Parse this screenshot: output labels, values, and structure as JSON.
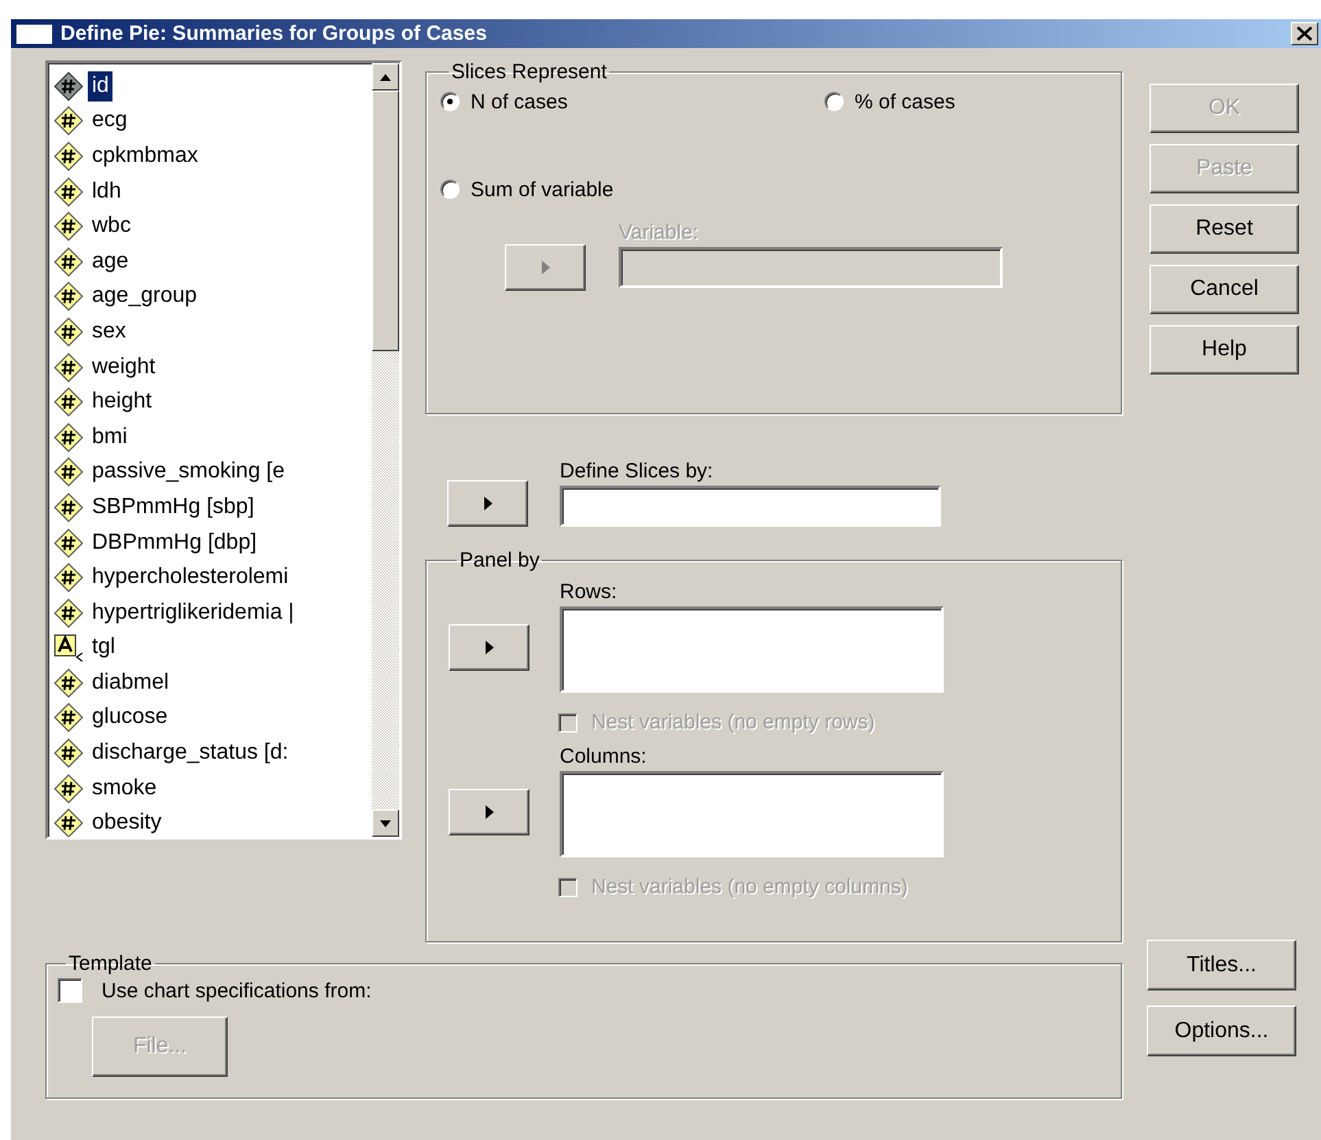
{
  "window": {
    "title": "Define Pie: Summaries for Groups of Cases"
  },
  "variables": [
    {
      "name": "id",
      "kind": "scale",
      "selected": true
    },
    {
      "name": "ecg",
      "kind": "scale",
      "selected": false
    },
    {
      "name": "cpkmbmax",
      "kind": "scale",
      "selected": false
    },
    {
      "name": "ldh",
      "kind": "scale",
      "selected": false
    },
    {
      "name": "wbc",
      "kind": "scale",
      "selected": false
    },
    {
      "name": "age",
      "kind": "scale",
      "selected": false
    },
    {
      "name": "age_group",
      "kind": "scale",
      "selected": false
    },
    {
      "name": "sex",
      "kind": "scale",
      "selected": false
    },
    {
      "name": "weight",
      "kind": "scale",
      "selected": false
    },
    {
      "name": "height",
      "kind": "scale",
      "selected": false
    },
    {
      "name": "bmi",
      "kind": "scale",
      "selected": false
    },
    {
      "name": "passive_smoking [e",
      "kind": "scale",
      "selected": false
    },
    {
      "name": "SBPmmHg [sbp]",
      "kind": "scale",
      "selected": false
    },
    {
      "name": "DBPmmHg [dbp]",
      "kind": "scale",
      "selected": false
    },
    {
      "name": "hypercholesterolemi",
      "kind": "scale",
      "selected": false
    },
    {
      "name": "hypertriglikeridemia |",
      "kind": "scale",
      "selected": false
    },
    {
      "name": "tgl",
      "kind": "string",
      "selected": false
    },
    {
      "name": "diabmel",
      "kind": "scale",
      "selected": false
    },
    {
      "name": "glucose",
      "kind": "scale",
      "selected": false
    },
    {
      "name": "discharge_status [d:",
      "kind": "scale",
      "selected": false
    },
    {
      "name": "smoke",
      "kind": "scale",
      "selected": false
    },
    {
      "name": "obesity",
      "kind": "scale",
      "selected": false
    }
  ],
  "slices_represent": {
    "label": "Slices Represent",
    "options": [
      {
        "label": "N of cases",
        "selected": true
      },
      {
        "label": "% of cases",
        "selected": false
      },
      {
        "label": "Sum of variable",
        "selected": false
      }
    ],
    "variable": {
      "label": "Variable:",
      "disabled": true
    }
  },
  "define_slices": {
    "label": "Define Slices by:"
  },
  "panel_by": {
    "label": "Panel by",
    "rows": {
      "label": "Rows:",
      "nest": {
        "label": "Nest variables (no empty rows)",
        "checked": false,
        "disabled": true
      }
    },
    "columns": {
      "label": "Columns:",
      "nest": {
        "label": "Nest variables (no empty columns)",
        "checked": false,
        "disabled": true
      }
    }
  },
  "template": {
    "label": "Template",
    "use": {
      "label": "Use chart specifications from:",
      "checked": false
    },
    "file_button": {
      "label": "File...",
      "disabled": true
    }
  },
  "buttons": [
    {
      "label": "OK",
      "disabled": true
    },
    {
      "label": "Paste",
      "disabled": true
    },
    {
      "label": "Reset",
      "disabled": false
    },
    {
      "label": "Cancel",
      "disabled": false
    },
    {
      "label": "Help",
      "disabled": false
    }
  ],
  "side_buttons": [
    {
      "label": "Titles...",
      "disabled": false
    },
    {
      "label": "Options...",
      "disabled": false
    }
  ]
}
